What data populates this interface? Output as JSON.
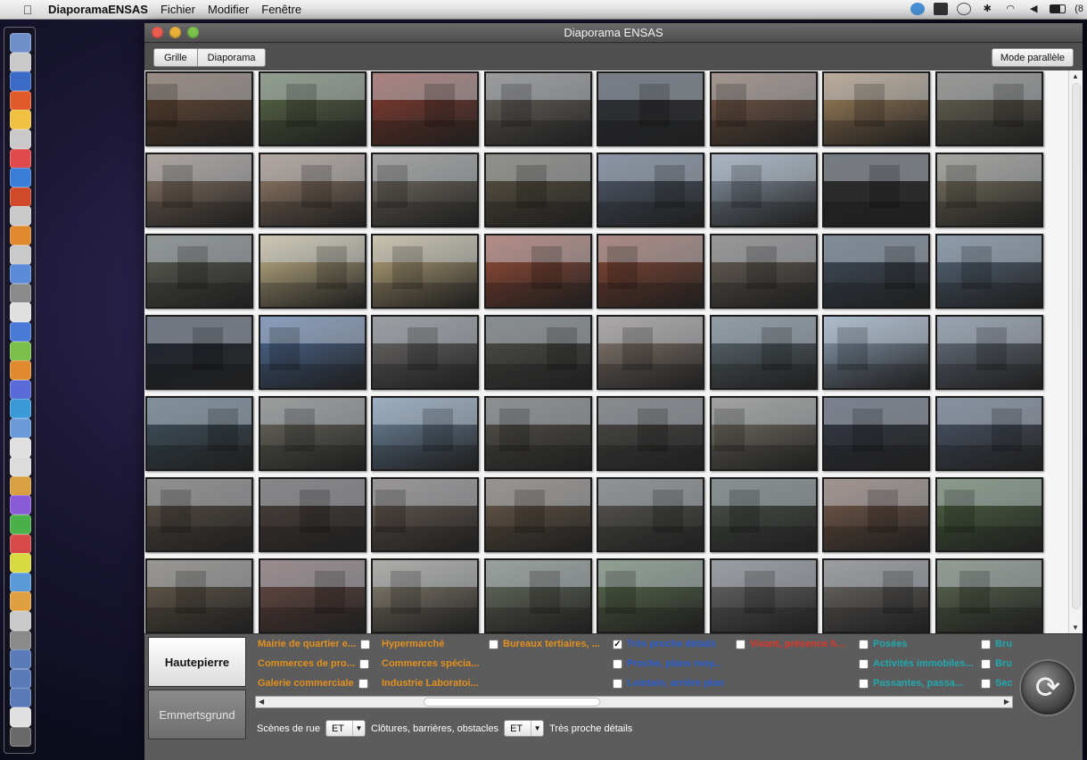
{
  "menubar": {
    "app_name": "DiaporamaENSAS",
    "menus": [
      "Fichier",
      "Modifier",
      "Fenêtre"
    ],
    "battery_text": "(8"
  },
  "window": {
    "title": "Diaporama ENSAS",
    "view_tabs": [
      "Grille",
      "Diaporama"
    ],
    "mode_button": "Mode parallèle"
  },
  "thumbnails": {
    "colors": [
      [
        "#6b4a33",
        "#5c6b46",
        "#8a3a2c",
        "#6d6760",
        "#2e3037",
        "#7c5c47",
        "#a7865c",
        "#6a6555"
      ],
      [
        "#8c7766",
        "#9a7f6a",
        "#7a7368",
        "#5b5340",
        "#4f5a6c",
        "#8a97a6",
        "#2a2c2a",
        "#7c7562"
      ],
      [
        "#5c5e54",
        "#c9b98a",
        "#c0ad7f",
        "#9c4a34",
        "#8a4530",
        "#6a6158",
        "#3e4b5a",
        "#55677a"
      ],
      [
        "#1f2430",
        "#4b6a98",
        "#6e6c6a",
        "#4e4f49",
        "#8c7e74",
        "#5c6a72",
        "#8da0b6",
        "#6a7482"
      ],
      [
        "#3e5360",
        "#6d6b60",
        "#6e88a2",
        "#55524a",
        "#4a4946",
        "#7a7568",
        "#333845",
        "#4a5568"
      ],
      [
        "#5b5046",
        "#4a3f3a",
        "#6b5d54",
        "#6b5a48",
        "#5a5852",
        "#4a524a",
        "#7a5a48",
        "#4e6540"
      ],
      [
        "#6a5e4e",
        "#6b4a44",
        "#8e8676",
        "#6a7060",
        "#5b6e4e",
        "#6a6b6a",
        "#6e6a66",
        "#5e6a50"
      ]
    ]
  },
  "sites": [
    "Hautepierre",
    "Emmertsgrund"
  ],
  "categories": {
    "col1": [
      "Mairie de quartier e...",
      "Commerces de pro...",
      "Galerie commerciale"
    ],
    "col2": [
      "Hypermarché",
      "Commerces spécia...",
      "Industrie Laboratoi..."
    ],
    "col3": [
      "Bureaux tertiaires, ..."
    ],
    "col4": [
      "Très proche détails",
      "Proche, plans moy...",
      "Lointain, arrière plan"
    ],
    "col5": [
      "Vivant, présence h..."
    ],
    "col6": [
      "Posées",
      "Activités immobiles...",
      "Passantes, passa..."
    ],
    "col7": [
      "Bru",
      "Bru",
      "Sec"
    ]
  },
  "colors": {
    "orange": "#e3901d",
    "red": "#e0342a",
    "blue": "#2a5fd6",
    "teal": "#1faab0"
  },
  "filters": {
    "label1": "Scènes de rue",
    "op1": "ET",
    "label2": "Clôtures, barrières, obstacles",
    "op2": "ET",
    "label3": "Très proche détails"
  },
  "icons": {
    "refresh": "refresh-icon"
  }
}
